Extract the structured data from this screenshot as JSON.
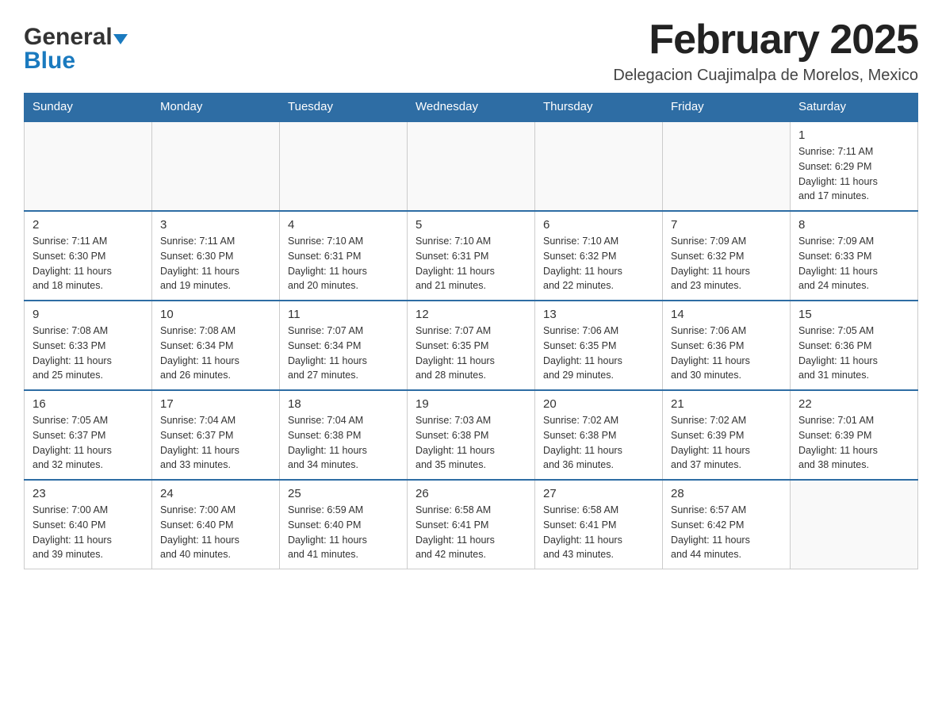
{
  "header": {
    "logo_general": "General",
    "logo_blue": "Blue",
    "month_title": "February 2025",
    "subtitle": "Delegacion Cuajimalpa de Morelos, Mexico"
  },
  "days_of_week": [
    "Sunday",
    "Monday",
    "Tuesday",
    "Wednesday",
    "Thursday",
    "Friday",
    "Saturday"
  ],
  "weeks": [
    {
      "days": [
        {
          "number": "",
          "info": ""
        },
        {
          "number": "",
          "info": ""
        },
        {
          "number": "",
          "info": ""
        },
        {
          "number": "",
          "info": ""
        },
        {
          "number": "",
          "info": ""
        },
        {
          "number": "",
          "info": ""
        },
        {
          "number": "1",
          "info": "Sunrise: 7:11 AM\nSunset: 6:29 PM\nDaylight: 11 hours\nand 17 minutes."
        }
      ]
    },
    {
      "days": [
        {
          "number": "2",
          "info": "Sunrise: 7:11 AM\nSunset: 6:30 PM\nDaylight: 11 hours\nand 18 minutes."
        },
        {
          "number": "3",
          "info": "Sunrise: 7:11 AM\nSunset: 6:30 PM\nDaylight: 11 hours\nand 19 minutes."
        },
        {
          "number": "4",
          "info": "Sunrise: 7:10 AM\nSunset: 6:31 PM\nDaylight: 11 hours\nand 20 minutes."
        },
        {
          "number": "5",
          "info": "Sunrise: 7:10 AM\nSunset: 6:31 PM\nDaylight: 11 hours\nand 21 minutes."
        },
        {
          "number": "6",
          "info": "Sunrise: 7:10 AM\nSunset: 6:32 PM\nDaylight: 11 hours\nand 22 minutes."
        },
        {
          "number": "7",
          "info": "Sunrise: 7:09 AM\nSunset: 6:32 PM\nDaylight: 11 hours\nand 23 minutes."
        },
        {
          "number": "8",
          "info": "Sunrise: 7:09 AM\nSunset: 6:33 PM\nDaylight: 11 hours\nand 24 minutes."
        }
      ]
    },
    {
      "days": [
        {
          "number": "9",
          "info": "Sunrise: 7:08 AM\nSunset: 6:33 PM\nDaylight: 11 hours\nand 25 minutes."
        },
        {
          "number": "10",
          "info": "Sunrise: 7:08 AM\nSunset: 6:34 PM\nDaylight: 11 hours\nand 26 minutes."
        },
        {
          "number": "11",
          "info": "Sunrise: 7:07 AM\nSunset: 6:34 PM\nDaylight: 11 hours\nand 27 minutes."
        },
        {
          "number": "12",
          "info": "Sunrise: 7:07 AM\nSunset: 6:35 PM\nDaylight: 11 hours\nand 28 minutes."
        },
        {
          "number": "13",
          "info": "Sunrise: 7:06 AM\nSunset: 6:35 PM\nDaylight: 11 hours\nand 29 minutes."
        },
        {
          "number": "14",
          "info": "Sunrise: 7:06 AM\nSunset: 6:36 PM\nDaylight: 11 hours\nand 30 minutes."
        },
        {
          "number": "15",
          "info": "Sunrise: 7:05 AM\nSunset: 6:36 PM\nDaylight: 11 hours\nand 31 minutes."
        }
      ]
    },
    {
      "days": [
        {
          "number": "16",
          "info": "Sunrise: 7:05 AM\nSunset: 6:37 PM\nDaylight: 11 hours\nand 32 minutes."
        },
        {
          "number": "17",
          "info": "Sunrise: 7:04 AM\nSunset: 6:37 PM\nDaylight: 11 hours\nand 33 minutes."
        },
        {
          "number": "18",
          "info": "Sunrise: 7:04 AM\nSunset: 6:38 PM\nDaylight: 11 hours\nand 34 minutes."
        },
        {
          "number": "19",
          "info": "Sunrise: 7:03 AM\nSunset: 6:38 PM\nDaylight: 11 hours\nand 35 minutes."
        },
        {
          "number": "20",
          "info": "Sunrise: 7:02 AM\nSunset: 6:38 PM\nDaylight: 11 hours\nand 36 minutes."
        },
        {
          "number": "21",
          "info": "Sunrise: 7:02 AM\nSunset: 6:39 PM\nDaylight: 11 hours\nand 37 minutes."
        },
        {
          "number": "22",
          "info": "Sunrise: 7:01 AM\nSunset: 6:39 PM\nDaylight: 11 hours\nand 38 minutes."
        }
      ]
    },
    {
      "days": [
        {
          "number": "23",
          "info": "Sunrise: 7:00 AM\nSunset: 6:40 PM\nDaylight: 11 hours\nand 39 minutes."
        },
        {
          "number": "24",
          "info": "Sunrise: 7:00 AM\nSunset: 6:40 PM\nDaylight: 11 hours\nand 40 minutes."
        },
        {
          "number": "25",
          "info": "Sunrise: 6:59 AM\nSunset: 6:40 PM\nDaylight: 11 hours\nand 41 minutes."
        },
        {
          "number": "26",
          "info": "Sunrise: 6:58 AM\nSunset: 6:41 PM\nDaylight: 11 hours\nand 42 minutes."
        },
        {
          "number": "27",
          "info": "Sunrise: 6:58 AM\nSunset: 6:41 PM\nDaylight: 11 hours\nand 43 minutes."
        },
        {
          "number": "28",
          "info": "Sunrise: 6:57 AM\nSunset: 6:42 PM\nDaylight: 11 hours\nand 44 minutes."
        },
        {
          "number": "",
          "info": ""
        }
      ]
    }
  ]
}
